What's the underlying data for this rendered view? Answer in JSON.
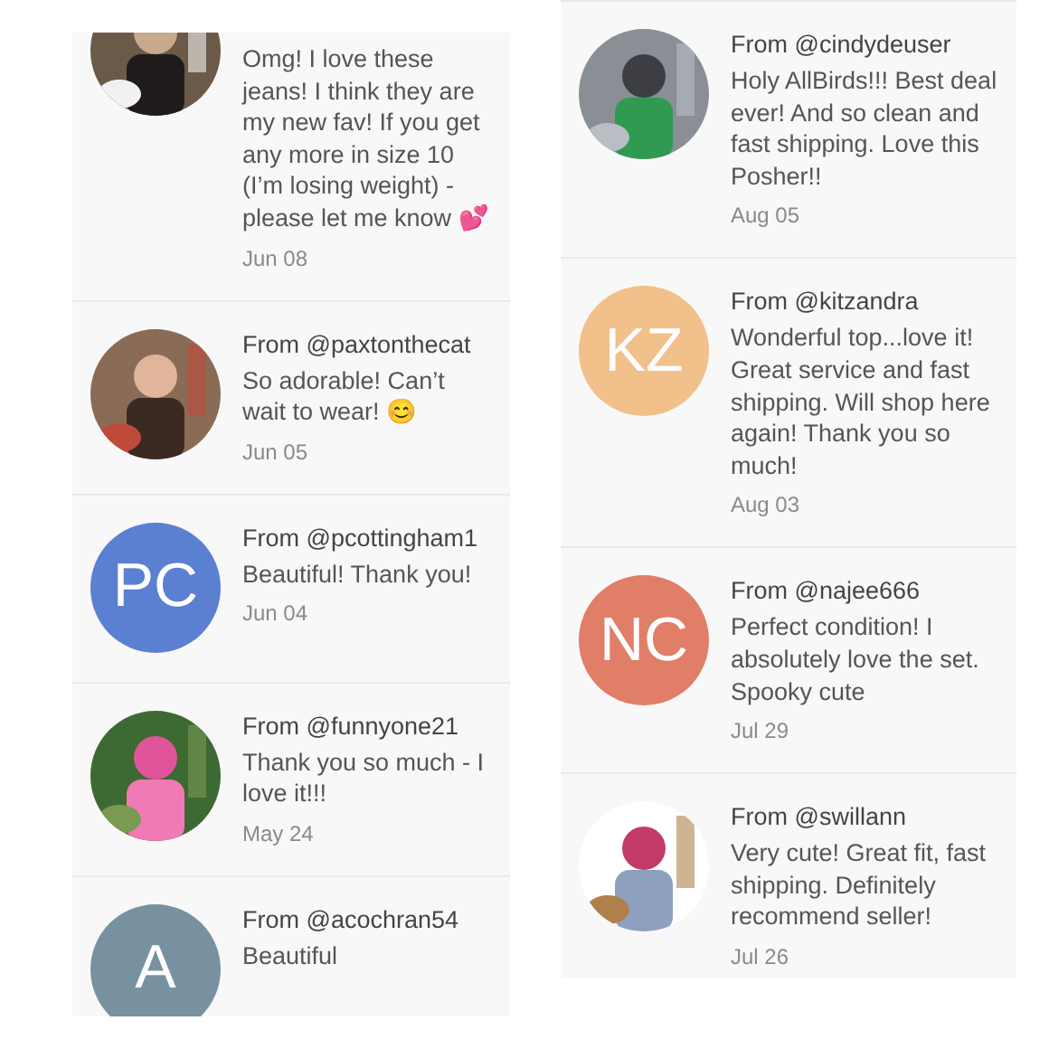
{
  "columns": [
    {
      "reviews": [
        {
          "message": "Omg! I love these jeans! I think they are my new fav! If you get any more in size 10 (I’m losing weight) - please let me know 💕",
          "date": "Jun 08"
        },
        {
          "from": "From @paxtonthecat",
          "message": "So adorable! Can’t wait to wear! 😊",
          "date": "Jun 05"
        },
        {
          "avatar": {
            "kind": "initials",
            "initials": "PC",
            "color": "#5b7fd1"
          },
          "from": "From @pcottingham1",
          "message": "Beautiful! Thank you!",
          "date": "Jun 04"
        },
        {
          "from": "From @funnyone21",
          "message": "Thank you so much - I love it!!!",
          "date": "May 24"
        },
        {
          "avatar": {
            "kind": "initials",
            "initials": "A",
            "color": "#7891a0"
          },
          "from": "From @acochran54",
          "message": "Beautiful"
        }
      ]
    },
    {
      "reviews": [
        {
          "from": "From @cindydeuser",
          "message": "Holy AllBirds!!! Best deal ever! And so clean and fast shipping. Love this Posher!!",
          "date": "Aug 05"
        },
        {
          "avatar": {
            "kind": "initials",
            "initials": "KZ",
            "color": "#f2c08a"
          },
          "from": "From @kitzandra",
          "message": "Wonderful top...love it! Great service and fast shipping. Will shop here again! Thank you so much!",
          "date": "Aug 03"
        },
        {
          "avatar": {
            "kind": "initials",
            "initials": "NC",
            "color": "#e07e68"
          },
          "from": "From @najee666",
          "message": "Perfect condition! I absolutely love the set. Spooky cute",
          "date": "Jul 29"
        },
        {
          "from": "From @swillann",
          "message": "Very cute! Great fit, fast shipping. Definitely recommend seller!",
          "date": "Jul 26"
        }
      ]
    }
  ]
}
